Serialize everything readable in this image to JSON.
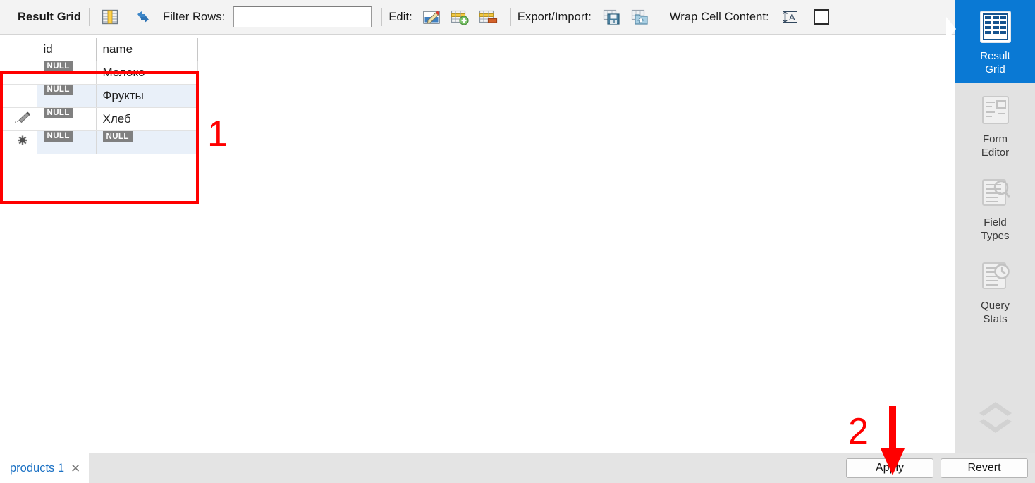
{
  "toolbar": {
    "result_grid_label": "Result Grid",
    "grid_icon": "grid-columns-icon",
    "refresh_icon": "refresh-icon",
    "filter_label": "Filter Rows:",
    "filter_value": "",
    "filter_placeholder": "",
    "edit_label": "Edit:",
    "edit_icon": "edit-pencil-icon",
    "insert_row_icon": "insert-row-icon",
    "delete_row_icon": "delete-row-icon",
    "export_import_label": "Export/Import:",
    "export_icon": "export-floppy-icon",
    "import_icon": "import-folder-icon",
    "wrap_cell_label": "Wrap Cell Content:",
    "wrap_cell_icon": "wrap-text-icon",
    "wrap_checkbox_checked": false
  },
  "grid": {
    "columns": [
      "",
      "id",
      "name"
    ],
    "rows": [
      {
        "marker": "",
        "id": "NULL",
        "name": "Молоко",
        "id_is_null": true,
        "name_is_null": false
      },
      {
        "marker": "",
        "id": "NULL",
        "name": "Фрукты",
        "id_is_null": true,
        "name_is_null": false
      },
      {
        "marker": "edit-pencil-marker",
        "id": "NULL",
        "name": "Хлеб",
        "id_is_null": true,
        "name_is_null": false
      },
      {
        "marker": "new-row-asterisk-marker",
        "id": "NULL",
        "name": "NULL",
        "id_is_null": true,
        "name_is_null": true
      }
    ],
    "null_text": "NULL"
  },
  "annotations": [
    {
      "label": "1",
      "kind": "rectangle-callout"
    },
    {
      "label": "2",
      "kind": "arrow-callout"
    }
  ],
  "sidebar": {
    "items": [
      {
        "label_line1": "Result",
        "label_line2": "Grid",
        "icon": "result-grid-icon",
        "active": true
      },
      {
        "label_line1": "Form",
        "label_line2": "Editor",
        "icon": "form-editor-icon",
        "active": false
      },
      {
        "label_line1": "Field",
        "label_line2": "Types",
        "icon": "field-types-icon",
        "active": false
      },
      {
        "label_line1": "Query",
        "label_line2": "Stats",
        "icon": "query-stats-icon",
        "active": false
      }
    ],
    "scroll_up_icon": "chevron-up-icon",
    "scroll_down_icon": "chevron-down-icon",
    "active_color": "#0a79d4"
  },
  "bottom": {
    "tab_label": "products 1",
    "tab_close_icon": "close-icon",
    "apply_label": "Apply",
    "revert_label": "Revert"
  },
  "colors": {
    "accent": "#0a79d4",
    "annotation": "#ff0000",
    "null_badge": "#808080",
    "row_alt": "#e9f0f9",
    "tab_text": "#1d72c4"
  }
}
